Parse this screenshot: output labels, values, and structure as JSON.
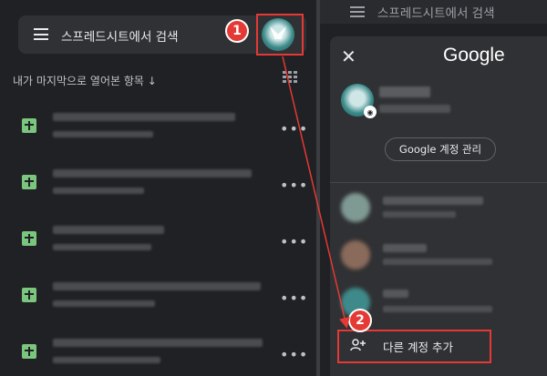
{
  "left_pane": {
    "search_placeholder": "스프레드시트에서 검색",
    "sort_label": "내가 마지막으로 열어본 항목",
    "sort_arrow": "↓",
    "more_label": "•••"
  },
  "right_pane": {
    "top_search_text": "스프레드시트에서 검색",
    "close_label": "✕",
    "google_label": "Google",
    "manage_account_label": "Google 계정 관리",
    "add_account_label": "다른 계정 추가",
    "camera_glyph": "◉"
  },
  "callouts": {
    "step1": "1",
    "step2": "2"
  },
  "colors": {
    "background": "#202124",
    "surface": "#303134",
    "sheets_green": "#7bc67e",
    "callout_red": "#e53935"
  }
}
